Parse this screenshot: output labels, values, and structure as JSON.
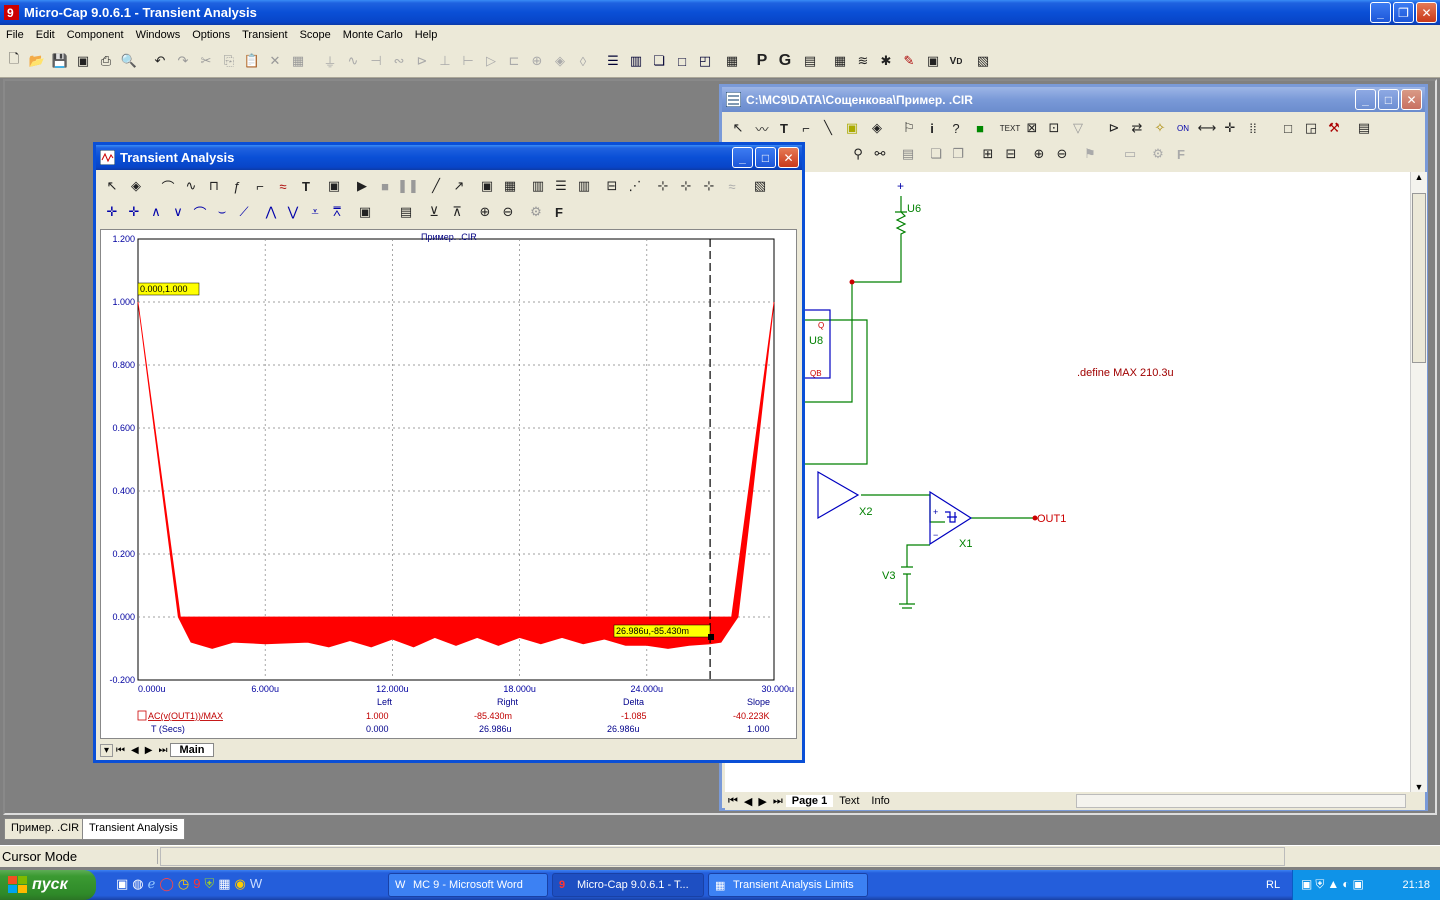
{
  "app": {
    "title": "Micro-Cap 9.0.6.1 - Transient Analysis",
    "menu": [
      "File",
      "Edit",
      "Component",
      "Windows",
      "Options",
      "Transient",
      "Scope",
      "Monte Carlo",
      "Help"
    ]
  },
  "schematic": {
    "title": "C:\\MC9\\DATA\\Сощенкова\\Пример. .CIR",
    "define_text": ".define MAX 210.3u",
    "labels": [
      "U6",
      "U8",
      "X2",
      "X1",
      "V3",
      "OUT1",
      "Q",
      "QB"
    ],
    "page_tabs": [
      "Page 1",
      "Text",
      "Info"
    ]
  },
  "transient": {
    "title": "Transient Analysis",
    "plot_title": "Пример. .CIR",
    "sheet_tab": "Main",
    "cursor_label_left": "0.000,1.000",
    "cursor_label_right": "26.986u,-85.430m",
    "readout": {
      "headers": [
        "Left",
        "Right",
        "Delta",
        "Slope"
      ],
      "row1_name": "AC(v(OUT1))/MAX",
      "row1": [
        "1.000",
        "-85.430m",
        "-1.085",
        "-40.223K"
      ],
      "row2_name": "T (Secs)",
      "row2": [
        "0.000",
        "26.986u",
        "26.986u",
        "1.000"
      ]
    }
  },
  "chart_data": {
    "type": "area",
    "title": "Пример. .CIR",
    "xlabel": "T (Secs)",
    "ylabel": "AC(v(OUT1))/MAX",
    "xlim": [
      0,
      30
    ],
    "ylim": [
      -0.2,
      1.2
    ],
    "x_ticks": [
      "0.000u",
      "6.000u",
      "12.000u",
      "18.000u",
      "24.000u",
      "30.000u"
    ],
    "y_ticks": [
      "1.200",
      "1.000",
      "0.800",
      "0.600",
      "0.400",
      "0.200",
      "0.000",
      "-0.200"
    ],
    "grid": true,
    "cursor_x": 26.986,
    "upper_envelope": {
      "x": [
        0,
        2,
        28,
        30
      ],
      "y": [
        1.0,
        0.0,
        0.0,
        1.0
      ]
    },
    "lower_envelope": {
      "x": [
        0,
        1.9,
        2.5,
        3.5,
        4.5,
        6,
        8,
        9,
        10,
        11,
        12,
        13,
        14,
        15,
        16,
        17,
        18,
        19,
        20,
        21,
        22,
        23,
        24,
        25,
        26,
        26.986,
        27.5,
        28,
        28.3,
        29,
        30
      ],
      "y": [
        1.0,
        0.0,
        -0.08,
        -0.1,
        -0.08,
        -0.085,
        -0.08,
        -0.095,
        -0.075,
        -0.095,
        -0.07,
        -0.095,
        -0.065,
        -0.09,
        -0.065,
        -0.09,
        -0.065,
        -0.085,
        -0.065,
        -0.085,
        -0.07,
        -0.09,
        -0.09,
        -0.1,
        -0.09,
        -0.085,
        -0.08,
        -0.03,
        0.0,
        0.4,
        1.0
      ]
    },
    "colors": {
      "fill": "#ff0000",
      "axis": "#0000a0",
      "grid": "#808080"
    }
  },
  "status": {
    "mode": "Cursor Mode"
  },
  "bottom_tabs": [
    "Пример. .CIR",
    "Transient Analysis"
  ],
  "taskbar": {
    "start": "пуск",
    "tasks": [
      "MC 9 - Microsoft Word",
      "Micro-Cap 9.0.6.1 - T...",
      "Transient Analysis Limits"
    ],
    "lang": "RL",
    "clock": "21:18"
  }
}
